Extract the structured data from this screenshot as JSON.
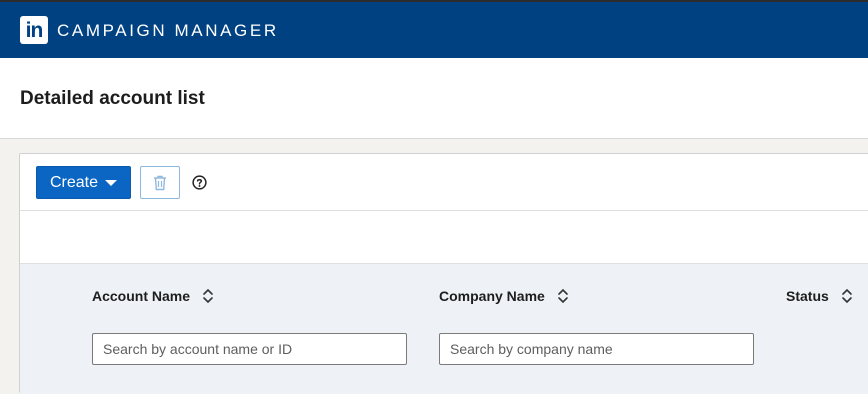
{
  "app": {
    "logo_text": "in",
    "title": "CAMPAIGN MANAGER"
  },
  "page": {
    "title": "Detailed account list"
  },
  "toolbar": {
    "create_label": "Create",
    "delete_icon": "trash-icon",
    "help_icon": "question-circle-icon"
  },
  "table": {
    "columns": [
      {
        "label": "Account Name",
        "sort_icon": "sort-icon"
      },
      {
        "label": "Company Name",
        "sort_icon": "sort-icon"
      },
      {
        "label": "Status",
        "sort_icon": "sort-icon"
      }
    ],
    "filters": {
      "account_placeholder": "Search by account name or ID",
      "account_value": "",
      "company_placeholder": "Search by company name",
      "company_value": ""
    }
  },
  "colors": {
    "topbar": "#004182",
    "primary_button": "#0a66c2",
    "table_header_bg": "#eef2f6"
  }
}
